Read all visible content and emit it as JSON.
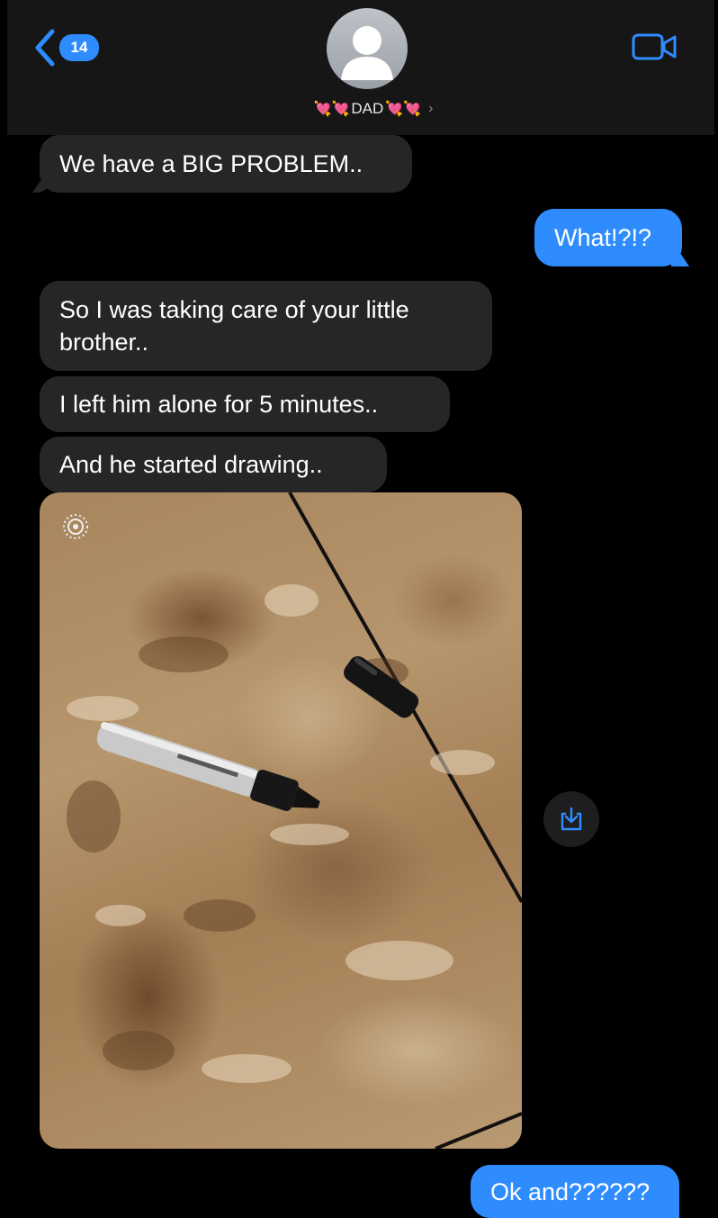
{
  "header": {
    "back_badge_count": "14",
    "contact_name": "DAD",
    "contact_emoji_left": "💘💘",
    "contact_emoji_right": "💘💘",
    "chevron": "›"
  },
  "messages": [
    {
      "direction": "incoming",
      "text": "We have a BIG PROBLEM.."
    },
    {
      "direction": "outgoing",
      "text": "What!?!?"
    },
    {
      "direction": "incoming",
      "text_line1": "So I was taking care of your little",
      "text_line2": "brother.."
    },
    {
      "direction": "incoming",
      "text": "I left him alone for 5 minutes.."
    },
    {
      "direction": "incoming",
      "text": "And he started drawing.."
    },
    {
      "direction": "incoming",
      "type": "photo",
      "content": "marker on tile floor"
    },
    {
      "direction": "outgoing",
      "text": "Ok and??????"
    }
  ],
  "colors": {
    "accent_blue": "#2f8cff",
    "incoming_bubble": "#262629",
    "background": "#000000"
  },
  "icons": [
    "chevron-left-icon",
    "avatar-icon",
    "video-call-icon",
    "save-to-photos-icon",
    "live-photo-icon"
  ]
}
